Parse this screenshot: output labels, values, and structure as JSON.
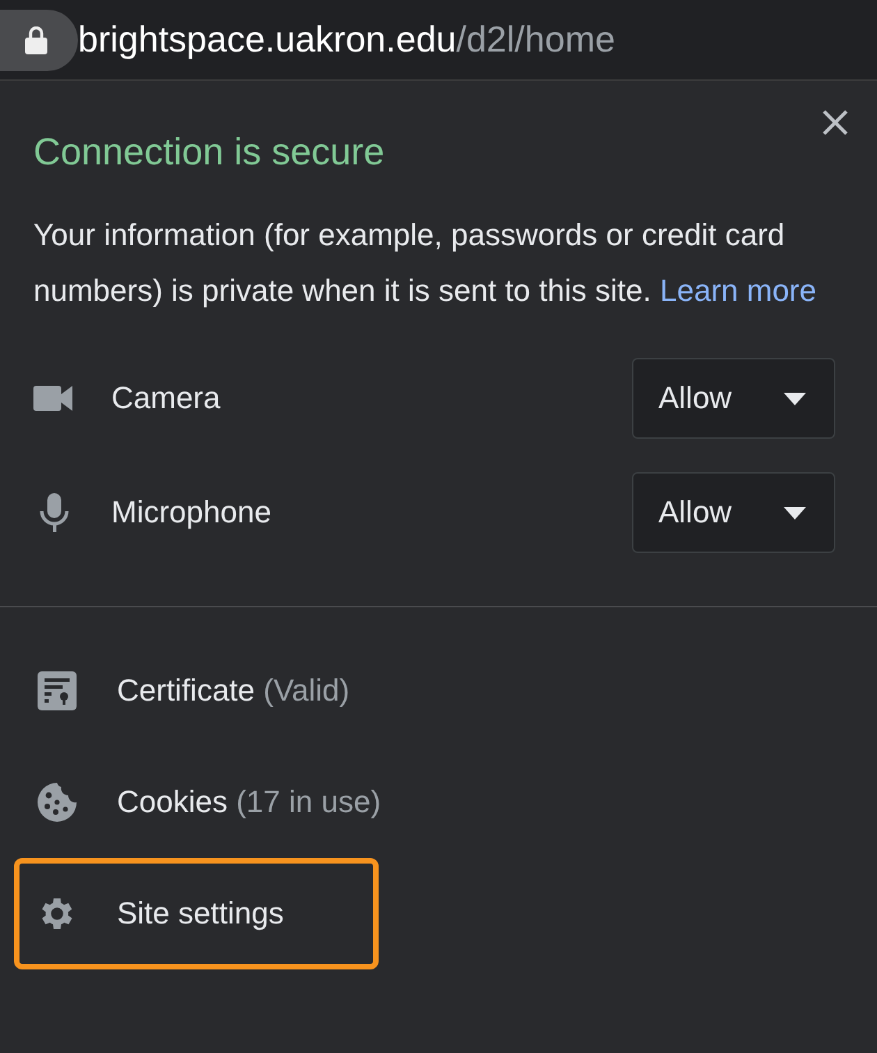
{
  "address_bar": {
    "host": "brightspace.uakron.edu",
    "path": "/d2l/home"
  },
  "popup": {
    "title": "Connection is secure",
    "description": "Your information (for example, passwords or credit card numbers) is private when it is sent to this site.",
    "link": "Learn more",
    "permissions": [
      {
        "kind": "camera",
        "label": "Camera",
        "value": "Allow"
      },
      {
        "kind": "microphone",
        "label": "Microphone",
        "value": "Allow"
      }
    ],
    "items": [
      {
        "kind": "certificate",
        "label": "Certificate",
        "detail": "(Valid)",
        "highlighted": false
      },
      {
        "kind": "cookies",
        "label": "Cookies",
        "detail": "(17 in use)",
        "highlighted": false
      },
      {
        "kind": "settings",
        "label": "Site settings",
        "highlighted": true
      }
    ]
  }
}
